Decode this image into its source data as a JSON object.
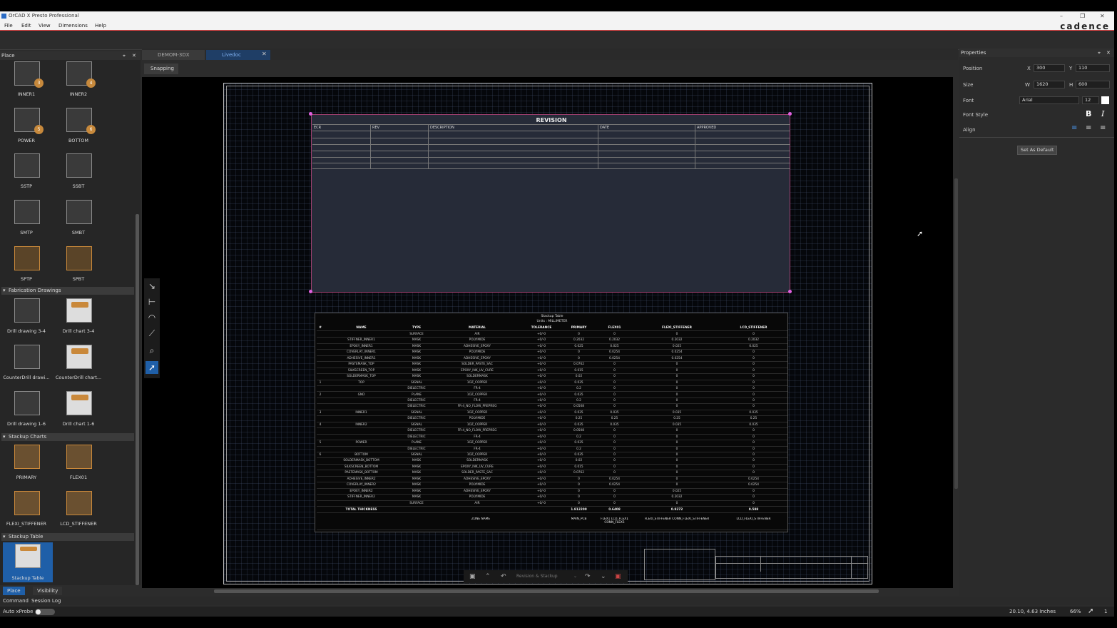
{
  "window": {
    "title": "OrCAD X Presto Professional",
    "logo": "cadence"
  },
  "menu": [
    "File",
    "Edit",
    "View",
    "Dimensions",
    "Help"
  ],
  "place_panel": {
    "title": "Place",
    "items": [
      {
        "label": "INNER1",
        "badge": "3"
      },
      {
        "label": "INNER2",
        "badge": "4"
      },
      {
        "label": "POWER",
        "badge": "5"
      },
      {
        "label": "BOTTOM",
        "badge": "6"
      },
      {
        "label": "SSTP"
      },
      {
        "label": "SSBT"
      },
      {
        "label": "SMTP"
      },
      {
        "label": "SMBT"
      },
      {
        "label": "SPTP"
      },
      {
        "label": "SPBT"
      }
    ],
    "sections": [
      "Fabrication Drawings",
      "Stackup Charts",
      "Stackup Table"
    ],
    "fab": [
      {
        "label": "Drill drawing 3-4"
      },
      {
        "label": "Drill chart 3-4"
      },
      {
        "label": "CounterDrill drawi..."
      },
      {
        "label": "CounterDrill chart..."
      },
      {
        "label": "Drill drawing 1-6"
      },
      {
        "label": "Drill chart 1-6"
      }
    ],
    "charts": [
      {
        "label": "PRIMARY"
      },
      {
        "label": "FLEX01"
      },
      {
        "label": "FLEXI_STIFFENER"
      },
      {
        "label": "LCD_STIFFENER"
      }
    ],
    "table": [
      {
        "label": "Stackup Table"
      }
    ],
    "tabs": [
      "Place",
      "Visibility"
    ]
  },
  "doc_tabs": [
    "DEMOM-3DX",
    "Livedoc"
  ],
  "snapping": "Snapping",
  "revision": {
    "title": "REVISION",
    "cols": [
      "ECR",
      "REV",
      "DESCRIPTION",
      "DATE",
      "APPROVED"
    ]
  },
  "stackup": {
    "title": "Stackup Table",
    "units": "Units : MILLIMETER",
    "headers": [
      "#",
      "NAME",
      "TYPE",
      "MATERIAL",
      "TOLERANCE",
      "PRIMARY",
      "FLEX01",
      "FLEXI_STIFFENER",
      "LCD_STIFFENER"
    ],
    "rows": [
      [
        "",
        "",
        "SURFACE",
        "AIR",
        "+0/-0",
        "0",
        "0",
        "0",
        "0"
      ],
      [
        "",
        "STIFFNER_INNER1",
        "MASK",
        "POLYIMIDE",
        "+0/-0",
        "0.2032",
        "0.2032",
        "0.2032",
        "0.2032"
      ],
      [
        "",
        "EPOXY_INNER1",
        "MASK",
        "ADHESIVE_EPOXY",
        "+0/-0",
        "0.025",
        "0.025",
        "0.025",
        "0.025"
      ],
      [
        "",
        "COVERLAY_INNER1",
        "MASK",
        "POLYIMIDE",
        "+0/-0",
        "0",
        "0.0254",
        "0.0254",
        "0"
      ],
      [
        "",
        "ADHESIVE_INNER1",
        "MASK",
        "ADHESIVE_EPOXY",
        "+0/-0",
        "0",
        "0.0254",
        "0.0254",
        "0"
      ],
      [
        "",
        "PASTEMASK_TOP",
        "MASK",
        "SOLDER_PASTE_SAC",
        "+0/-0",
        "0.0762",
        "0",
        "0",
        "0"
      ],
      [
        "",
        "SILKSCREEN_TOP",
        "MASK",
        "EPOXY_INK_UV_CURE",
        "+0/-0",
        "0.015",
        "0",
        "0",
        "0"
      ],
      [
        "",
        "SOLDERMASK_TOP",
        "MASK",
        "SOLDERMASK",
        "+0/-0",
        "0.02",
        "0",
        "0",
        "0"
      ],
      [
        "1",
        "TOP",
        "SIGNAL",
        "1OZ_COPPER",
        "+0/-0",
        "0.035",
        "0",
        "0",
        "0"
      ],
      [
        "",
        "",
        "DIELECTRIC",
        "FR-4",
        "+0/-0",
        "0.2",
        "0",
        "0",
        "0"
      ],
      [
        "2",
        "GND",
        "PLANE",
        "1OZ_COPPER",
        "+0/-0",
        "0.035",
        "0",
        "0",
        "0"
      ],
      [
        "",
        "",
        "DIELECTRIC",
        "FR-4",
        "+0/-0",
        "0.2",
        "0",
        "0",
        "0"
      ],
      [
        "",
        "",
        "DIELECTRIC",
        "FR-4_NO_FLOW_PREPREG",
        "+0/-0",
        "0.0508",
        "0",
        "0",
        "0"
      ],
      [
        "3",
        "INNER1",
        "SIGNAL",
        "1OZ_COPPER",
        "+0/-0",
        "0.035",
        "0.035",
        "0.035",
        "0.035"
      ],
      [
        "",
        "",
        "DIELECTRIC",
        "POLYIMIDE",
        "+0/-0",
        "0.25",
        "0.25",
        "0.25",
        "0.25"
      ],
      [
        "4",
        "INNER2",
        "SIGNAL",
        "1OZ_COPPER",
        "+0/-0",
        "0.035",
        "0.035",
        "0.035",
        "0.035"
      ],
      [
        "",
        "",
        "DIELECTRIC",
        "FR-4_NO_FLOW_PREPREG",
        "+0/-0",
        "0.0508",
        "0",
        "0",
        "0"
      ],
      [
        "",
        "",
        "DIELECTRIC",
        "FR-4",
        "+0/-0",
        "0.2",
        "0",
        "0",
        "0"
      ],
      [
        "5",
        "POWER",
        "PLANE",
        "1OZ_COPPER",
        "+0/-0",
        "0.035",
        "0",
        "0",
        "0"
      ],
      [
        "",
        "",
        "DIELECTRIC",
        "FR-4",
        "+0/-0",
        "0.2",
        "0",
        "0",
        "0"
      ],
      [
        "6",
        "BOTTOM",
        "SIGNAL",
        "1OZ_COPPER",
        "+0/-0",
        "0.035",
        "0",
        "0",
        "0"
      ],
      [
        "",
        "SOLDERMASK_BOTTOM",
        "MASK",
        "SOLDERMASK",
        "+0/-0",
        "0.02",
        "0",
        "0",
        "0"
      ],
      [
        "",
        "SILKSCREEN_BOTTOM",
        "MASK",
        "EPOXY_INK_UV_CURE",
        "+0/-0",
        "0.015",
        "0",
        "0",
        "0"
      ],
      [
        "",
        "PASTEMASK_BOTTOM",
        "MASK",
        "SOLDER_PASTE_SAC",
        "+0/-0",
        "0.0762",
        "0",
        "0",
        "0"
      ],
      [
        "",
        "ADHESIVE_INNER2",
        "MASK",
        "ADHESIVE_EPOXY",
        "+0/-0",
        "0",
        "0.0254",
        "0",
        "0.0254"
      ],
      [
        "",
        "COVERLAY_INNER2",
        "MASK",
        "POLYIMIDE",
        "+0/-0",
        "0",
        "0.0254",
        "0",
        "0.0254"
      ],
      [
        "",
        "EPOXY_INNER2",
        "MASK",
        "ADHESIVE_EPOXY",
        "+0/-0",
        "0",
        "0",
        "0.025",
        "0"
      ],
      [
        "",
        "STIFFNER_INNER2",
        "MASK",
        "POLYIMIDE",
        "+0/-0",
        "0",
        "0",
        "0.2032",
        "0"
      ],
      [
        "",
        "",
        "SURFACE",
        "AIR",
        "+0/-0",
        "0",
        "0",
        "0",
        "0"
      ]
    ],
    "total": [
      "TOTAL THICKNESS",
      "1.812200",
      "0.6408",
      "0.8272",
      "0.588"
    ],
    "zone": [
      "ZONE NAME",
      "MAIN_PCB",
      "FLEX1 LCD_FLEX1 CONN_FLEX5",
      "FLEXI_STIFFENER CONN_FLEXI_STIFFENER",
      "LCD_FLEXI_STIFFENER"
    ]
  },
  "floatbar": "Revision & Stackup",
  "properties": {
    "title": "Properties",
    "position_label": "Position",
    "x_label": "X",
    "x": "300",
    "y_label": "Y",
    "y": "110",
    "size_label": "Size",
    "w_label": "W",
    "w": "1620",
    "h_label": "H",
    "h": "600",
    "font_label": "Font",
    "font": "Arial",
    "font_size": "12",
    "style_label": "Font Style",
    "bold": "B",
    "italic": "I",
    "align_label": "Align",
    "default_button": "Set As Default"
  },
  "bottom": {
    "tabs": [
      "Command",
      "Session Log"
    ],
    "autoxprobe": "Auto xProbe",
    "coords": "20.10, 4.63 Inches",
    "zoom": "66%",
    "count": "1"
  }
}
